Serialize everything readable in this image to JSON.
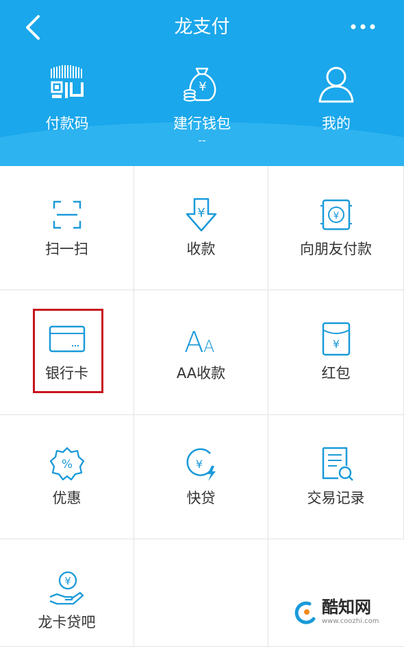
{
  "nav": {
    "title": "龙支付",
    "back_icon": "chevron-left-icon",
    "more_icon": "more-dots-icon"
  },
  "quick_actions": [
    {
      "label": "付款码",
      "icon": "qr-pay-icon"
    },
    {
      "label": "建行钱包",
      "sub": "--",
      "icon": "money-bag-icon"
    },
    {
      "label": "我的",
      "icon": "user-icon"
    }
  ],
  "grid": [
    {
      "label": "扫一扫",
      "icon": "scan-icon"
    },
    {
      "label": "收款",
      "icon": "receive-icon"
    },
    {
      "label": "向朋友付款",
      "icon": "transfer-friend-icon"
    },
    {
      "label": "银行卡",
      "icon": "bank-card-icon"
    },
    {
      "label": "AA收款",
      "icon": "aa-icon"
    },
    {
      "label": "红包",
      "icon": "red-packet-icon"
    },
    {
      "label": "优惠",
      "icon": "discount-icon"
    },
    {
      "label": "快贷",
      "icon": "quick-loan-icon"
    },
    {
      "label": "交易记录",
      "icon": "transaction-record-icon"
    },
    {
      "label": "龙卡贷吧",
      "icon": "dragon-card-loan-icon"
    }
  ],
  "highlighted_item": "银行卡",
  "watermark": {
    "name": "酷知网",
    "url": "www.coozhi.com"
  },
  "colors": {
    "header": "#1aa7eb",
    "icon": "#1a9ad9",
    "highlight": "#c8141e"
  }
}
